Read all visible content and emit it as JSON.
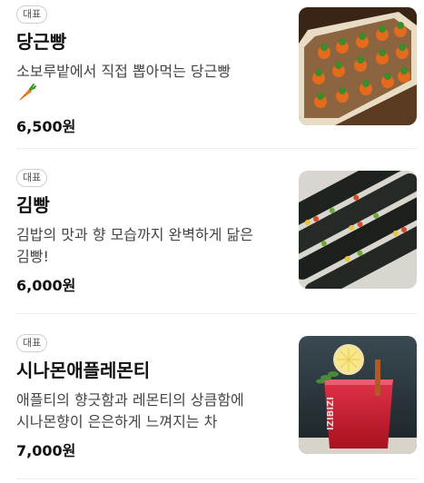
{
  "menu": {
    "items": [
      {
        "badge": "대표",
        "name": "당근빵",
        "description": "소보루밭에서 직접 뽑아먹는 당근빵",
        "description_icon": "carrot-icon",
        "price": "6,500원",
        "image": "carrot-bread-photo"
      },
      {
        "badge": "대표",
        "name": "김빵",
        "description": "김밥의 맛과 향 모습까지 완벽하게 닮은 김빵!",
        "price": "6,000원",
        "image": "gimbap-bread-photo"
      },
      {
        "badge": "대표",
        "name": "시나몬애플레몬티",
        "description": "애플티의 향긋함과 레몬티의 상큼함에 시나몬향이 은은하게 느껴지는 차",
        "price": "7,000원",
        "image": "cinnamon-apple-lemon-tea-photo",
        "image_text": "IZIBIZI"
      }
    ]
  }
}
